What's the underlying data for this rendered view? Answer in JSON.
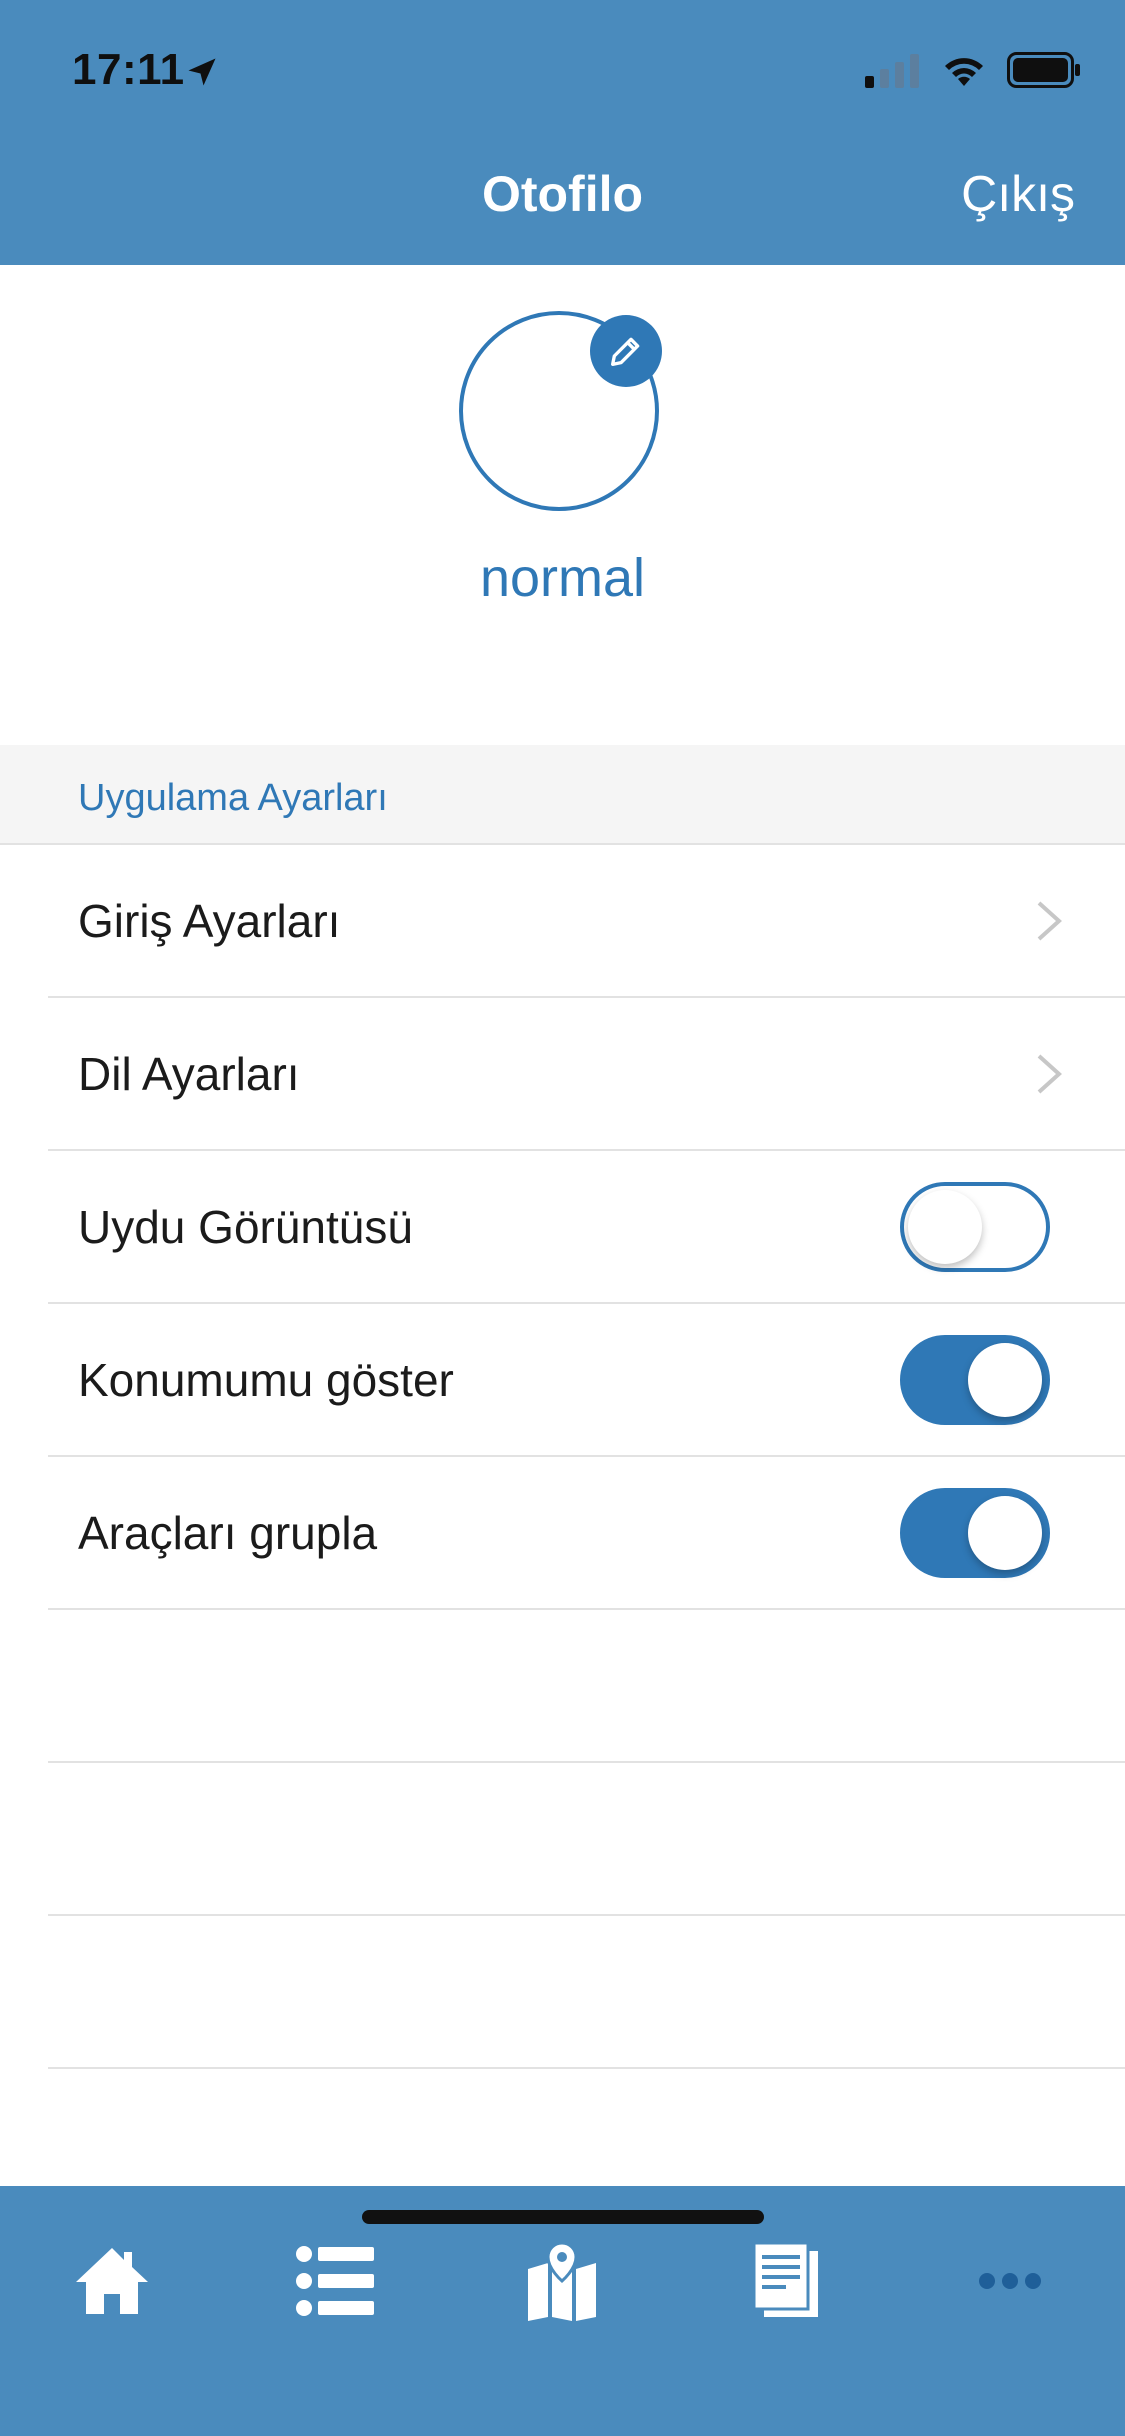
{
  "colors": {
    "brand": "#4a8bbd",
    "accent": "#2f78b6",
    "more_icon": "#1f5f99"
  },
  "status_bar": {
    "time": "17:11",
    "icons": [
      "location-arrow-icon",
      "signal-icon",
      "wifi-icon",
      "battery-icon"
    ]
  },
  "header": {
    "title": "Otofilo",
    "action_label": "Çıkış"
  },
  "profile": {
    "username": "normal",
    "edit_icon": "pencil-icon"
  },
  "settings": {
    "section_title": "Uygulama Ayarları",
    "items": [
      {
        "label": "Giriş Ayarları",
        "type": "nav",
        "icon": "chevron-right-icon"
      },
      {
        "label": "Dil Ayarları",
        "type": "nav",
        "icon": "chevron-right-icon"
      },
      {
        "label": "Uydu Görüntüsü",
        "type": "toggle",
        "value": false
      },
      {
        "label": "Konumumu göster",
        "type": "toggle",
        "value": true
      },
      {
        "label": "Araçları grupla",
        "type": "toggle",
        "value": true
      }
    ]
  },
  "tabbar": {
    "tabs": [
      {
        "name": "home",
        "icon": "home-icon"
      },
      {
        "name": "list",
        "icon": "list-icon"
      },
      {
        "name": "map",
        "icon": "map-pin-icon"
      },
      {
        "name": "reports",
        "icon": "document-icon"
      },
      {
        "name": "more",
        "icon": "more-icon"
      }
    ]
  }
}
